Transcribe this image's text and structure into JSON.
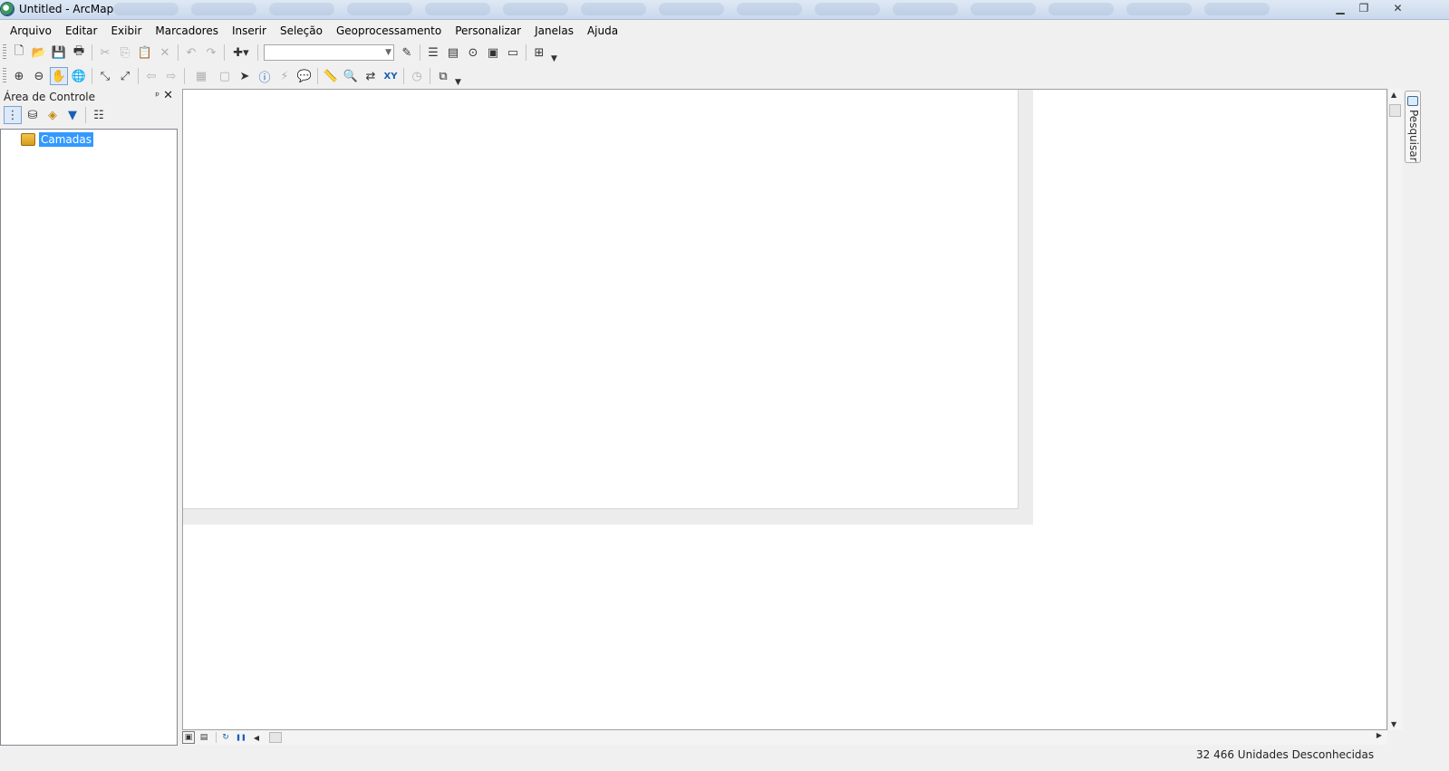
{
  "window": {
    "title": "Untitled - ArcMap",
    "minimize": "▁",
    "maximize": "❐",
    "close": "✕"
  },
  "menu": [
    "Arquivo",
    "Editar",
    "Exibir",
    "Marcadores",
    "Inserir",
    "Seleção",
    "Geoprocessamento",
    "Personalizar",
    "Janelas",
    "Ajuda"
  ],
  "toolbar_standard": {
    "icons": {
      "new": "🗋",
      "open": "📂",
      "save": "💾",
      "print": "🖶",
      "cut": "✂",
      "copy": "⎘",
      "paste": "📋",
      "delete": "✕",
      "undo": "↶",
      "redo": "↷",
      "add_data": "✚▾",
      "editor": "✎",
      "toc": "☰",
      "catalog": "▤",
      "search": "⊙",
      "arctoolbox": "▣",
      "python": "▭",
      "model": "⊞"
    },
    "scale_value": ""
  },
  "toolbar_tools": {
    "icons": {
      "zoom_in": "⊕",
      "zoom_out": "⊖",
      "pan": "✋",
      "full_extent": "🌐",
      "fixed_zoom_in": "⤡",
      "fixed_zoom_out": "⤢",
      "back": "⇦",
      "forward": "⇨",
      "select_features": "▦",
      "clear_selection": "▢",
      "select_elements": "➤",
      "identify": "ⓘ",
      "hyperlink": "⚡",
      "html_popup": "💬",
      "measure": "📏",
      "find": "🔍",
      "find_route": "⇄",
      "goto_xy": "XY",
      "time_slider": "◷",
      "viewer": "⧉"
    }
  },
  "toc": {
    "title": "Área de Controle",
    "pin": "ᵖ",
    "close": "✕",
    "icons": {
      "list_by_drawing_order": "⋮",
      "list_by_source": "⛁",
      "list_by_visibility": "◈",
      "list_by_selection": "▼",
      "options": "☷"
    },
    "root_label": "Camadas"
  },
  "side_tab": {
    "label": "Pesquisar"
  },
  "scroll": {
    "up": "▲",
    "down": "▼",
    "left": "◀",
    "right": "▶"
  },
  "view_buttons": {
    "data_view": "▣",
    "layout_view": "▤",
    "refresh": "↻",
    "pause": "❚❚"
  },
  "status": {
    "coordinates": "32   466 Unidades Desconhecidas"
  },
  "colors": {
    "selection": "#3399ff",
    "title_bar": "#dfe9f5"
  }
}
